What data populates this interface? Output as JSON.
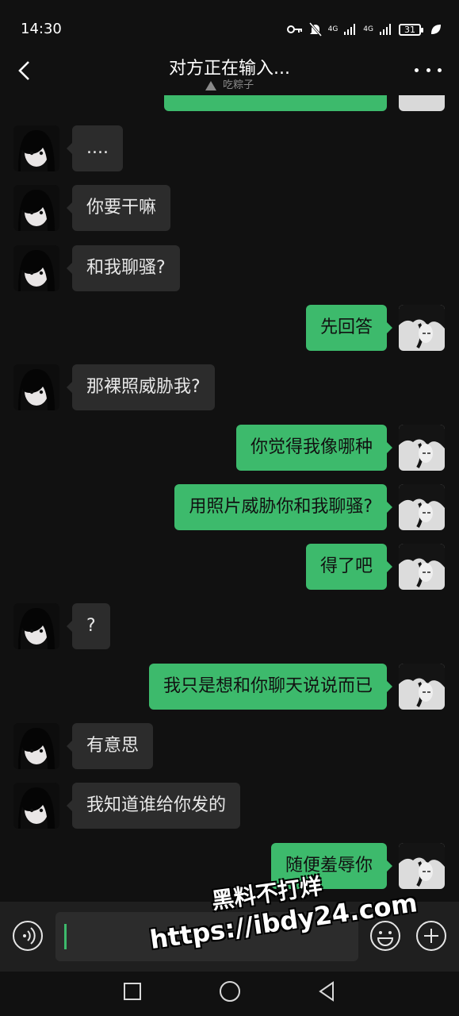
{
  "status_bar": {
    "time": "14:30",
    "network_1": "4G",
    "network_2": "4G",
    "battery": "31"
  },
  "header": {
    "title": "对方正在输入...",
    "subtitle": "吃粽子"
  },
  "messages": [
    {
      "side": "in",
      "text": "...."
    },
    {
      "side": "in",
      "text": "你要干嘛"
    },
    {
      "side": "in",
      "text": "和我聊骚?"
    },
    {
      "side": "out",
      "text": "先回答"
    },
    {
      "side": "in",
      "text": "那裸照威胁我?"
    },
    {
      "side": "out",
      "text": "你觉得我像哪种"
    },
    {
      "side": "out",
      "text": "用照片威胁你和我聊骚?"
    },
    {
      "side": "out",
      "text": "得了吧"
    },
    {
      "side": "in",
      "text": "?"
    },
    {
      "side": "out",
      "text": "我只是想和你聊天说说而已"
    },
    {
      "side": "in",
      "text": "有意思"
    },
    {
      "side": "in",
      "text": "我知道谁给你发的"
    },
    {
      "side": "out",
      "text": "随便羞辱你"
    }
  ],
  "input": {
    "value": "",
    "placeholder": ""
  },
  "watermark": {
    "line1": "黑料不打烊",
    "line2": "https://ibdy24.com"
  },
  "colors": {
    "background": "#111111",
    "incoming_bubble": "#2c2c2c",
    "outgoing_bubble": "#3dba6c",
    "input_bar": "#1f1f1f"
  }
}
